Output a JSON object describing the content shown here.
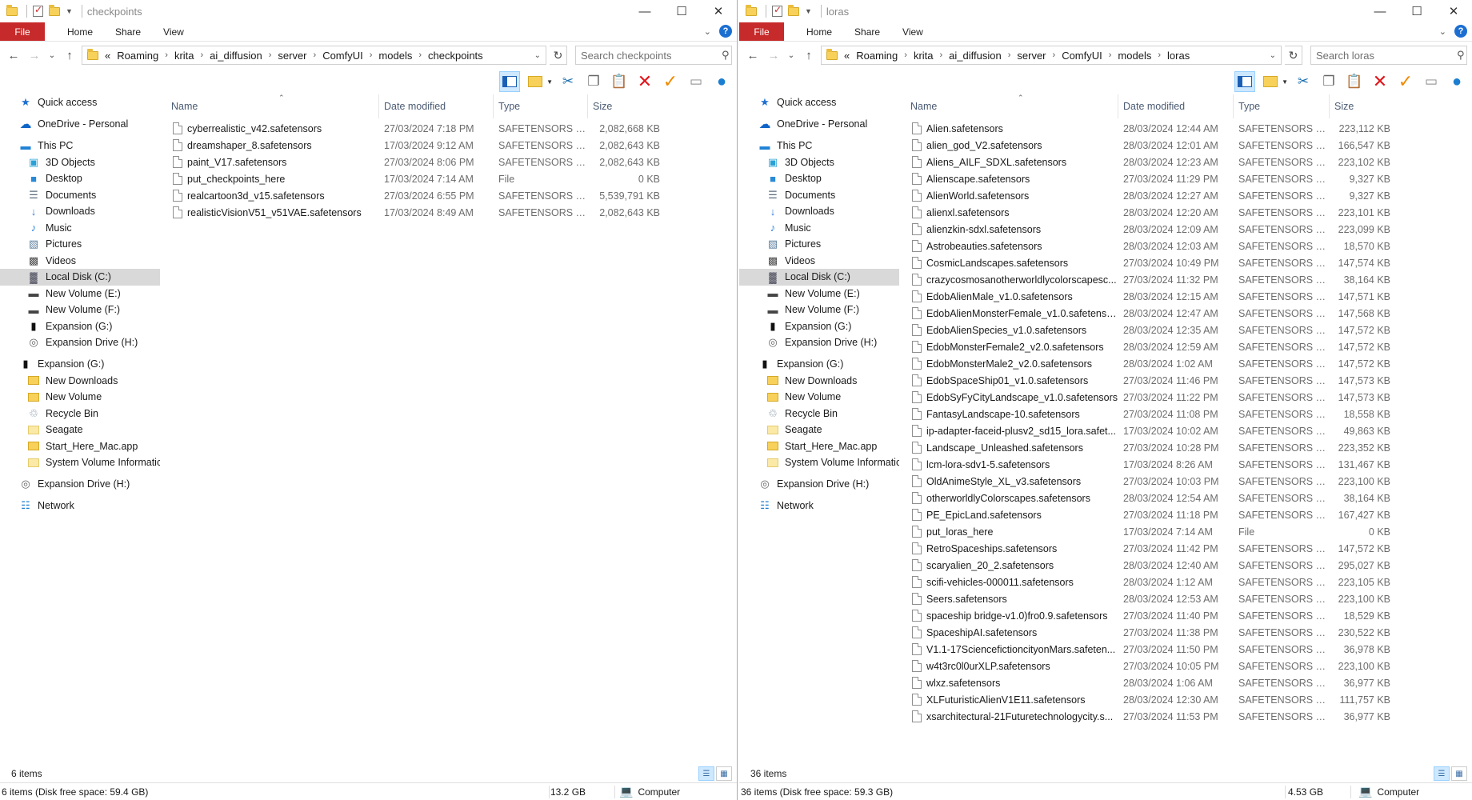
{
  "left": {
    "title": "checkpoints",
    "ribbon": {
      "file": "File",
      "home": "Home",
      "share": "Share",
      "view": "View"
    },
    "breadcrumb": [
      "«",
      "Roaming",
      "krita",
      "ai_diffusion",
      "server",
      "ComfyUI",
      "models",
      "checkpoints"
    ],
    "search_placeholder": "Search checkpoints",
    "columns": {
      "name": "Name",
      "date": "Date modified",
      "type": "Type",
      "size": "Size"
    },
    "files": [
      {
        "name": "cyberrealistic_v42.safetensors",
        "date": "27/03/2024 7:18 PM",
        "type": "SAFETENSORS File",
        "size": "2,082,668 KB"
      },
      {
        "name": "dreamshaper_8.safetensors",
        "date": "17/03/2024 9:12 AM",
        "type": "SAFETENSORS File",
        "size": "2,082,643 KB"
      },
      {
        "name": "paint_V17.safetensors",
        "date": "27/03/2024 8:06 PM",
        "type": "SAFETENSORS File",
        "size": "2,082,643 KB"
      },
      {
        "name": "put_checkpoints_here",
        "date": "17/03/2024 7:14 AM",
        "type": "File",
        "size": "0 KB"
      },
      {
        "name": "realcartoon3d_v15.safetensors",
        "date": "27/03/2024 6:55 PM",
        "type": "SAFETENSORS File",
        "size": "5,539,791 KB"
      },
      {
        "name": "realisticVisionV51_v51VAE.safetensors",
        "date": "17/03/2024 8:49 AM",
        "type": "SAFETENSORS File",
        "size": "2,082,643 KB"
      }
    ],
    "item_count": "6 items",
    "status": {
      "left": "6 items (Disk free space: 59.4 GB)",
      "size": "13.2 GB",
      "computer": "Computer"
    }
  },
  "right": {
    "title": "loras",
    "ribbon": {
      "file": "File",
      "home": "Home",
      "share": "Share",
      "view": "View"
    },
    "breadcrumb": [
      "«",
      "Roaming",
      "krita",
      "ai_diffusion",
      "server",
      "ComfyUI",
      "models",
      "loras"
    ],
    "search_placeholder": "Search loras",
    "columns": {
      "name": "Name",
      "date": "Date modified",
      "type": "Type",
      "size": "Size"
    },
    "files": [
      {
        "name": "Alien.safetensors",
        "date": "28/03/2024 12:44 AM",
        "type": "SAFETENSORS File",
        "size": "223,112 KB"
      },
      {
        "name": "alien_god_V2.safetensors",
        "date": "28/03/2024 12:01 AM",
        "type": "SAFETENSORS File",
        "size": "166,547 KB"
      },
      {
        "name": "Aliens_AILF_SDXL.safetensors",
        "date": "28/03/2024 12:23 AM",
        "type": "SAFETENSORS File",
        "size": "223,102 KB"
      },
      {
        "name": "Alienscape.safetensors",
        "date": "27/03/2024 11:29 PM",
        "type": "SAFETENSORS File",
        "size": "9,327 KB"
      },
      {
        "name": "AlienWorld.safetensors",
        "date": "28/03/2024 12:27 AM",
        "type": "SAFETENSORS File",
        "size": "9,327 KB"
      },
      {
        "name": "alienxl.safetensors",
        "date": "28/03/2024 12:20 AM",
        "type": "SAFETENSORS File",
        "size": "223,101 KB"
      },
      {
        "name": "alienzkin-sdxl.safetensors",
        "date": "28/03/2024 12:09 AM",
        "type": "SAFETENSORS File",
        "size": "223,099 KB"
      },
      {
        "name": "Astrobeauties.safetensors",
        "date": "28/03/2024 12:03 AM",
        "type": "SAFETENSORS File",
        "size": "18,570 KB"
      },
      {
        "name": "CosmicLandscapes.safetensors",
        "date": "27/03/2024 10:49 PM",
        "type": "SAFETENSORS File",
        "size": "147,574 KB"
      },
      {
        "name": "crazycosmosanotherworldlycolorscapesc...",
        "date": "27/03/2024 11:32 PM",
        "type": "SAFETENSORS File",
        "size": "38,164 KB"
      },
      {
        "name": "EdobAlienMale_v1.0.safetensors",
        "date": "28/03/2024 12:15 AM",
        "type": "SAFETENSORS File",
        "size": "147,571 KB"
      },
      {
        "name": "EdobAlienMonsterFemale_v1.0.safetensors",
        "date": "28/03/2024 12:47 AM",
        "type": "SAFETENSORS File",
        "size": "147,568 KB"
      },
      {
        "name": "EdobAlienSpecies_v1.0.safetensors",
        "date": "28/03/2024 12:35 AM",
        "type": "SAFETENSORS File",
        "size": "147,572 KB"
      },
      {
        "name": "EdobMonsterFemale2_v2.0.safetensors",
        "date": "28/03/2024 12:59 AM",
        "type": "SAFETENSORS File",
        "size": "147,572 KB"
      },
      {
        "name": "EdobMonsterMale2_v2.0.safetensors",
        "date": "28/03/2024 1:02 AM",
        "type": "SAFETENSORS File",
        "size": "147,572 KB"
      },
      {
        "name": "EdobSpaceShip01_v1.0.safetensors",
        "date": "27/03/2024 11:46 PM",
        "type": "SAFETENSORS File",
        "size": "147,573 KB"
      },
      {
        "name": "EdobSyFyCityLandscape_v1.0.safetensors",
        "date": "27/03/2024 11:22 PM",
        "type": "SAFETENSORS File",
        "size": "147,573 KB"
      },
      {
        "name": "FantasyLandscape-10.safetensors",
        "date": "27/03/2024 11:08 PM",
        "type": "SAFETENSORS File",
        "size": "18,558 KB"
      },
      {
        "name": "ip-adapter-faceid-plusv2_sd15_lora.safet...",
        "date": "17/03/2024 10:02 AM",
        "type": "SAFETENSORS File",
        "size": "49,863 KB"
      },
      {
        "name": "Landscape_Unleashed.safetensors",
        "date": "27/03/2024 10:28 PM",
        "type": "SAFETENSORS File",
        "size": "223,352 KB"
      },
      {
        "name": "lcm-lora-sdv1-5.safetensors",
        "date": "17/03/2024 8:26 AM",
        "type": "SAFETENSORS File",
        "size": "131,467 KB"
      },
      {
        "name": "OldAnimeStyle_XL_v3.safetensors",
        "date": "27/03/2024 10:03 PM",
        "type": "SAFETENSORS File",
        "size": "223,100 KB"
      },
      {
        "name": "otherworldlyColorscapes.safetensors",
        "date": "28/03/2024 12:54 AM",
        "type": "SAFETENSORS File",
        "size": "38,164 KB"
      },
      {
        "name": "PE_EpicLand.safetensors",
        "date": "27/03/2024 11:18 PM",
        "type": "SAFETENSORS File",
        "size": "167,427 KB"
      },
      {
        "name": "put_loras_here",
        "date": "17/03/2024 7:14 AM",
        "type": "File",
        "size": "0 KB"
      },
      {
        "name": "RetroSpaceships.safetensors",
        "date": "27/03/2024 11:42 PM",
        "type": "SAFETENSORS File",
        "size": "147,572 KB"
      },
      {
        "name": "scaryalien_20_2.safetensors",
        "date": "28/03/2024 12:40 AM",
        "type": "SAFETENSORS File",
        "size": "295,027 KB"
      },
      {
        "name": "scifi-vehicles-000011.safetensors",
        "date": "28/03/2024 1:12 AM",
        "type": "SAFETENSORS File",
        "size": "223,105 KB"
      },
      {
        "name": "Seers.safetensors",
        "date": "28/03/2024 12:53 AM",
        "type": "SAFETENSORS File",
        "size": "223,100 KB"
      },
      {
        "name": "spaceship bridge-v1.0)fro0.9.safetensors",
        "date": "27/03/2024 11:40 PM",
        "type": "SAFETENSORS File",
        "size": "18,529 KB"
      },
      {
        "name": "SpaceshipAI.safetensors",
        "date": "27/03/2024 11:38 PM",
        "type": "SAFETENSORS File",
        "size": "230,522 KB"
      },
      {
        "name": "V1.1-17SciencefictioncityonMars.safeten...",
        "date": "27/03/2024 11:50 PM",
        "type": "SAFETENSORS File",
        "size": "36,978 KB"
      },
      {
        "name": "w4t3rc0l0urXLP.safetensors",
        "date": "27/03/2024 10:05 PM",
        "type": "SAFETENSORS File",
        "size": "223,100 KB"
      },
      {
        "name": "wlxz.safetensors",
        "date": "28/03/2024 1:06 AM",
        "type": "SAFETENSORS File",
        "size": "36,977 KB"
      },
      {
        "name": "XLFuturisticAlienV1E11.safetensors",
        "date": "28/03/2024 12:30 AM",
        "type": "SAFETENSORS File",
        "size": "111,757 KB"
      },
      {
        "name": "xsarchitectural-21Futuretechnologycity.s...",
        "date": "27/03/2024 11:53 PM",
        "type": "SAFETENSORS File",
        "size": "36,977 KB"
      }
    ],
    "item_count": "36 items",
    "status": {
      "left": "36 items (Disk free space: 59.3 GB)",
      "size": "4.53 GB",
      "computer": "Computer"
    }
  },
  "nav": [
    {
      "label": "Quick access",
      "icon": "star-icon",
      "level": 0,
      "gap": false
    },
    {
      "label": "OneDrive - Personal",
      "icon": "onedrive-cloud-icon",
      "level": 0,
      "gap": true
    },
    {
      "label": "This PC",
      "icon": "this-pc-icon",
      "level": 0,
      "gap": true
    },
    {
      "label": "3D Objects",
      "icon": "3d-objects-icon",
      "level": 1
    },
    {
      "label": "Desktop",
      "icon": "desktop-icon",
      "level": 1
    },
    {
      "label": "Documents",
      "icon": "documents-icon",
      "level": 1
    },
    {
      "label": "Downloads",
      "icon": "downloads-icon",
      "level": 1
    },
    {
      "label": "Music",
      "icon": "music-icon",
      "level": 1
    },
    {
      "label": "Pictures",
      "icon": "pictures-icon",
      "level": 1
    },
    {
      "label": "Videos",
      "icon": "videos-icon",
      "level": 1
    },
    {
      "label": "Local Disk (C:)",
      "icon": "local-disk-icon",
      "level": 1,
      "selected": true
    },
    {
      "label": "New Volume (E:)",
      "icon": "drive-icon",
      "level": 1
    },
    {
      "label": "New Volume (F:)",
      "icon": "drive-icon",
      "level": 1
    },
    {
      "label": "Expansion (G:)",
      "icon": "external-drive-icon",
      "level": 1
    },
    {
      "label": "Expansion Drive (H:)",
      "icon": "hdd-icon",
      "level": 1
    },
    {
      "label": "Expansion (G:)",
      "icon": "external-drive-icon",
      "level": 0,
      "gap": true
    },
    {
      "label": "New Downloads",
      "icon": "folder-icon",
      "level": 1
    },
    {
      "label": "New Volume",
      "icon": "folder-icon",
      "level": 1
    },
    {
      "label": "Recycle Bin",
      "icon": "recycle-bin-icon",
      "level": 1
    },
    {
      "label": "Seagate",
      "icon": "folder-pale-icon",
      "level": 1
    },
    {
      "label": "Start_Here_Mac.app",
      "icon": "folder-icon",
      "level": 1
    },
    {
      "label": "System Volume Informatic",
      "icon": "folder-pale-icon",
      "level": 1
    },
    {
      "label": "Expansion Drive (H:)",
      "icon": "hdd-icon",
      "level": 0,
      "gap": true
    },
    {
      "label": "Network",
      "icon": "network-icon",
      "level": 0,
      "gap": true
    }
  ],
  "nav_right_last_item": "System Volume Informatic"
}
